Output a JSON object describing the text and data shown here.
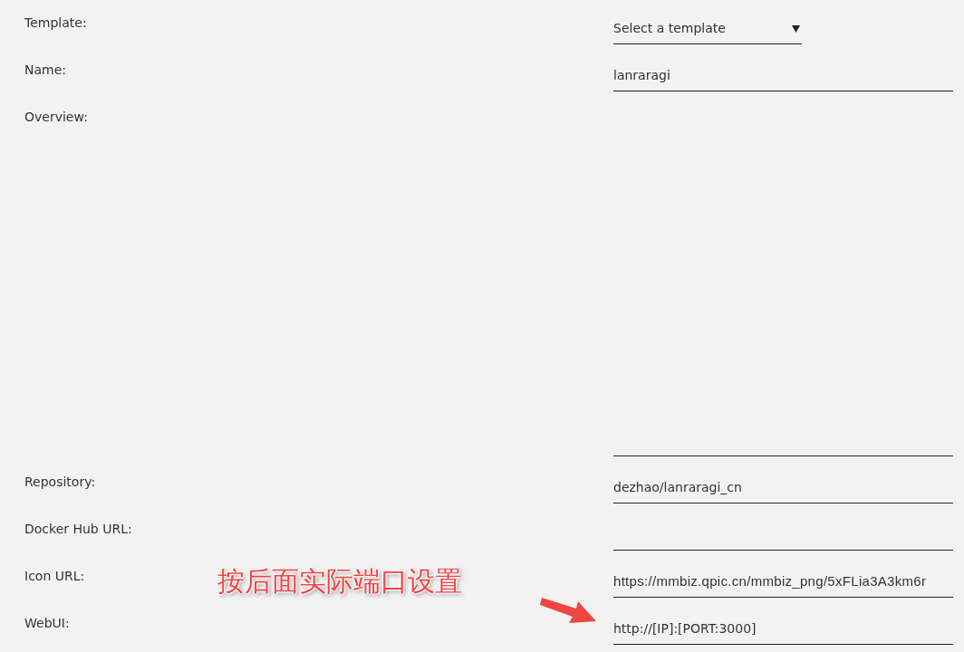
{
  "fields": [
    {
      "label": "Template:",
      "kind": "select",
      "value": "Select a template"
    },
    {
      "label": "Name:",
      "kind": "input",
      "value": "lanraragi"
    },
    {
      "label": "Overview:",
      "kind": "textarea"
    },
    {
      "label": "Repository:",
      "kind": "input",
      "value": "dezhao/lanraragi_cn"
    },
    {
      "label": "Docker Hub URL:",
      "kind": "input"
    },
    {
      "label": "Icon URL:",
      "kind": "input",
      "value": "https://mmbiz.qpic.cn/mmbiz_png/5xFLia3A3km6r"
    },
    {
      "label": "WebUI:",
      "kind": "input",
      "value": "http://[IP]:[PORT:3000]"
    }
  ],
  "annotation": {
    "text": "按后面实际端口设置"
  }
}
